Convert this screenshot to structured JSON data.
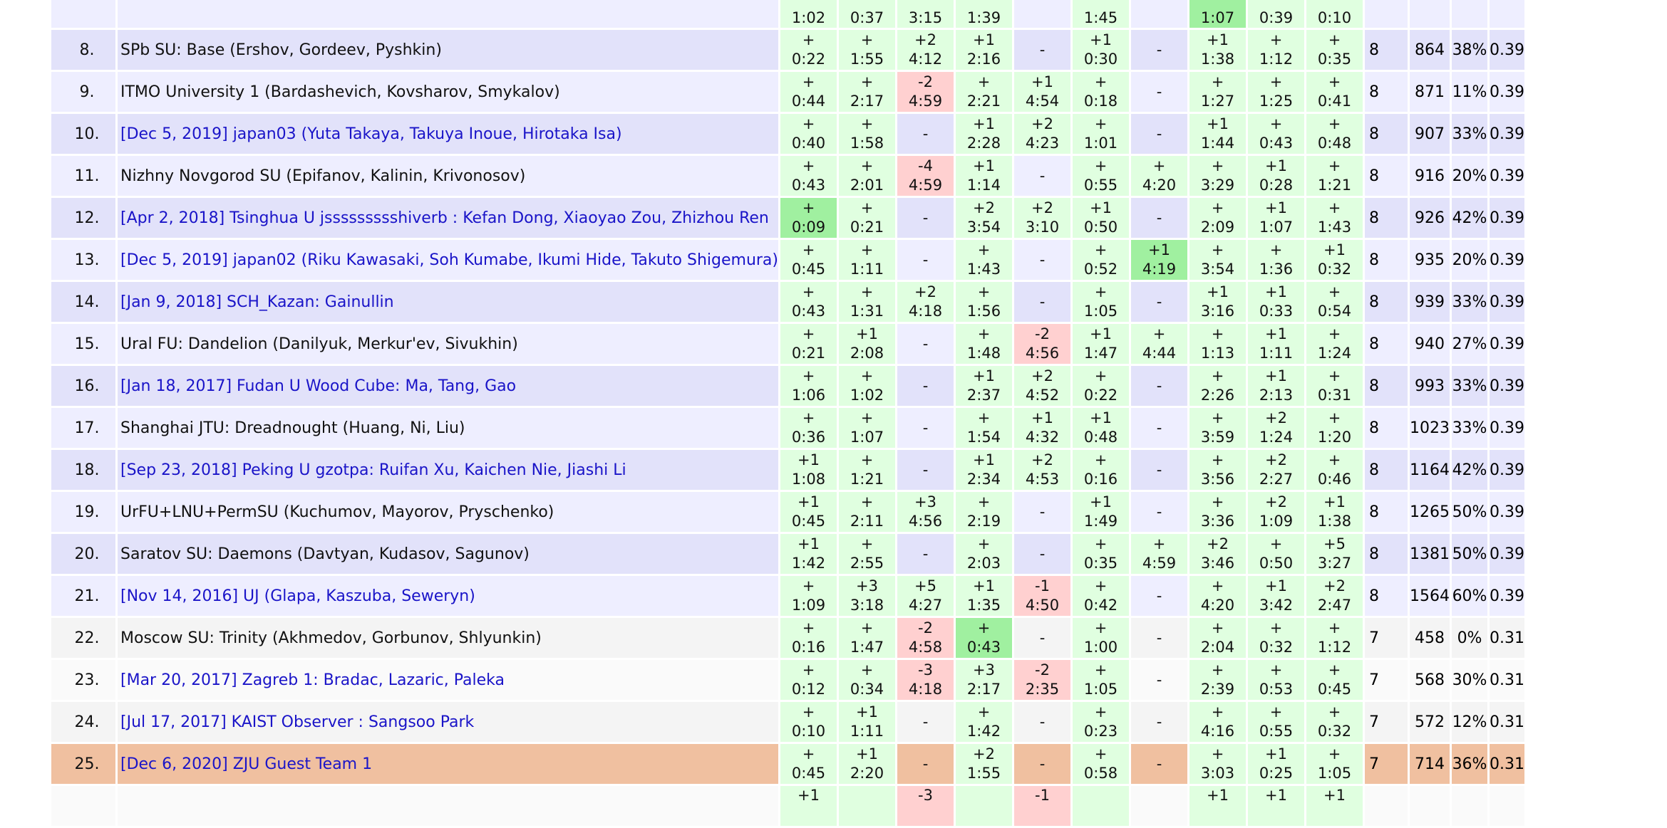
{
  "top_partial_row": {
    "cells": [
      "1:02",
      "0:37",
      "3:15",
      "1:39",
      "",
      "1:45",
      "",
      "1:07",
      "0:39",
      "0:10"
    ],
    "types": [
      "ok",
      "ok",
      "ok",
      "ok",
      "plain",
      "ok",
      "plain",
      "first",
      "ok",
      "ok"
    ]
  },
  "rows": [
    {
      "rank": "8.",
      "team": "SPb SU: Base (Ershov, Gordeev, Pyshkin)",
      "link": false,
      "group": "r",
      "probs": [
        [
          "+",
          "0:22",
          "ok"
        ],
        [
          "+",
          "1:55",
          "ok"
        ],
        [
          "+2",
          "4:12",
          "ok"
        ],
        [
          "+1",
          "2:16",
          "ok"
        ],
        [
          "-",
          "",
          "plain"
        ],
        [
          "+1",
          "0:30",
          "ok"
        ],
        [
          "-",
          "",
          "plain"
        ],
        [
          "+1",
          "1:38",
          "ok"
        ],
        [
          "+",
          "1:12",
          "ok"
        ],
        [
          "+",
          "0:35",
          "ok"
        ]
      ],
      "solved": "8",
      "penalty": "864",
      "rate": "38%",
      "dirt": "0.39"
    },
    {
      "rank": "9.",
      "team": "ITMO University 1 (Bardashevich, Kovsharov, Smykalov)",
      "link": false,
      "group": "r",
      "probs": [
        [
          "+",
          "0:44",
          "ok"
        ],
        [
          "+",
          "2:17",
          "ok"
        ],
        [
          "-2",
          "4:59",
          "fail"
        ],
        [
          "+",
          "2:21",
          "ok"
        ],
        [
          "+1",
          "4:54",
          "ok"
        ],
        [
          "+",
          "0:18",
          "ok"
        ],
        [
          "-",
          "",
          "plain"
        ],
        [
          "+",
          "1:27",
          "ok"
        ],
        [
          "+",
          "1:25",
          "ok"
        ],
        [
          "+",
          "0:41",
          "ok"
        ]
      ],
      "solved": "8",
      "penalty": "871",
      "rate": "11%",
      "dirt": "0.39"
    },
    {
      "rank": "10.",
      "team": "[Dec 5, 2019] japan03 (Yuta Takaya, Takuya Inoue, Hirotaka Isa)",
      "link": true,
      "group": "r",
      "probs": [
        [
          "+",
          "0:40",
          "ok"
        ],
        [
          "+",
          "1:58",
          "ok"
        ],
        [
          "-",
          "",
          "plain"
        ],
        [
          "+1",
          "2:28",
          "ok"
        ],
        [
          "+2",
          "4:23",
          "ok"
        ],
        [
          "+",
          "1:01",
          "ok"
        ],
        [
          "-",
          "",
          "plain"
        ],
        [
          "+1",
          "1:44",
          "ok"
        ],
        [
          "+",
          "0:43",
          "ok"
        ],
        [
          "+",
          "0:48",
          "ok"
        ]
      ],
      "solved": "8",
      "penalty": "907",
      "rate": "33%",
      "dirt": "0.39"
    },
    {
      "rank": "11.",
      "team": "Nizhny Novgorod SU (Epifanov, Kalinin, Krivonosov)",
      "link": false,
      "group": "r",
      "probs": [
        [
          "+",
          "0:43",
          "ok"
        ],
        [
          "+",
          "2:01",
          "ok"
        ],
        [
          "-4",
          "4:59",
          "fail"
        ],
        [
          "+1",
          "1:14",
          "ok"
        ],
        [
          "-",
          "",
          "plain"
        ],
        [
          "+",
          "0:55",
          "ok"
        ],
        [
          "+",
          "4:20",
          "ok"
        ],
        [
          "+",
          "3:29",
          "ok"
        ],
        [
          "+1",
          "0:28",
          "ok"
        ],
        [
          "+",
          "1:21",
          "ok"
        ]
      ],
      "solved": "8",
      "penalty": "916",
      "rate": "20%",
      "dirt": "0.39"
    },
    {
      "rank": "12.",
      "team": "[Apr 2, 2018] Tsinghua U jssssssssshiverb : Kefan Dong, Xiaoyao Zou, Zhizhou Ren",
      "link": true,
      "group": "r",
      "probs": [
        [
          "+",
          "0:09",
          "first"
        ],
        [
          "+",
          "0:21",
          "ok"
        ],
        [
          "-",
          "",
          "plain"
        ],
        [
          "+2",
          "3:54",
          "ok"
        ],
        [
          "+2",
          "3:10",
          "ok"
        ],
        [
          "+1",
          "0:50",
          "ok"
        ],
        [
          "-",
          "",
          "plain"
        ],
        [
          "+",
          "2:09",
          "ok"
        ],
        [
          "+1",
          "1:07",
          "ok"
        ],
        [
          "+",
          "1:43",
          "ok"
        ]
      ],
      "solved": "8",
      "penalty": "926",
      "rate": "42%",
      "dirt": "0.39"
    },
    {
      "rank": "13.",
      "team": "[Dec 5, 2019] japan02 (Riku Kawasaki, Soh Kumabe, Ikumi Hide, Takuto Shigemura)",
      "link": true,
      "group": "r",
      "probs": [
        [
          "+",
          "0:45",
          "ok"
        ],
        [
          "+",
          "1:11",
          "ok"
        ],
        [
          "-",
          "",
          "plain"
        ],
        [
          "+",
          "1:43",
          "ok"
        ],
        [
          "-",
          "",
          "plain"
        ],
        [
          "+",
          "0:52",
          "ok"
        ],
        [
          "+1",
          "4:19",
          "first"
        ],
        [
          "+",
          "3:54",
          "ok"
        ],
        [
          "+",
          "1:36",
          "ok"
        ],
        [
          "+1",
          "0:32",
          "ok"
        ]
      ],
      "solved": "8",
      "penalty": "935",
      "rate": "20%",
      "dirt": "0.39"
    },
    {
      "rank": "14.",
      "team": "[Jan 9, 2018] SCH_Kazan: Gainullin",
      "link": true,
      "group": "r",
      "probs": [
        [
          "+",
          "0:43",
          "ok"
        ],
        [
          "+",
          "1:31",
          "ok"
        ],
        [
          "+2",
          "4:18",
          "ok"
        ],
        [
          "+",
          "1:56",
          "ok"
        ],
        [
          "-",
          "",
          "plain"
        ],
        [
          "+",
          "1:05",
          "ok"
        ],
        [
          "-",
          "",
          "plain"
        ],
        [
          "+1",
          "3:16",
          "ok"
        ],
        [
          "+1",
          "0:33",
          "ok"
        ],
        [
          "+",
          "0:54",
          "ok"
        ]
      ],
      "solved": "8",
      "penalty": "939",
      "rate": "33%",
      "dirt": "0.39"
    },
    {
      "rank": "15.",
      "team": "Ural FU: Dandelion (Danilyuk, Merkur'ev, Sivukhin)",
      "link": false,
      "group": "r",
      "probs": [
        [
          "+",
          "0:21",
          "ok"
        ],
        [
          "+1",
          "2:08",
          "ok"
        ],
        [
          "-",
          "",
          "plain"
        ],
        [
          "+",
          "1:48",
          "ok"
        ],
        [
          "-2",
          "4:56",
          "fail"
        ],
        [
          "+1",
          "1:47",
          "ok"
        ],
        [
          "+",
          "4:44",
          "ok"
        ],
        [
          "+",
          "1:13",
          "ok"
        ],
        [
          "+1",
          "1:11",
          "ok"
        ],
        [
          "+",
          "1:24",
          "ok"
        ]
      ],
      "solved": "8",
      "penalty": "940",
      "rate": "27%",
      "dirt": "0.39"
    },
    {
      "rank": "16.",
      "team": "[Jan 18, 2017] Fudan U Wood Cube: Ma, Tang, Gao",
      "link": true,
      "group": "r",
      "probs": [
        [
          "+",
          "1:06",
          "ok"
        ],
        [
          "+",
          "1:02",
          "ok"
        ],
        [
          "-",
          "",
          "plain"
        ],
        [
          "+1",
          "2:37",
          "ok"
        ],
        [
          "+2",
          "4:52",
          "ok"
        ],
        [
          "+",
          "0:22",
          "ok"
        ],
        [
          "-",
          "",
          "plain"
        ],
        [
          "+",
          "2:26",
          "ok"
        ],
        [
          "+1",
          "2:13",
          "ok"
        ],
        [
          "+",
          "0:31",
          "ok"
        ]
      ],
      "solved": "8",
      "penalty": "993",
      "rate": "33%",
      "dirt": "0.39"
    },
    {
      "rank": "17.",
      "team": "Shanghai JTU: Dreadnought (Huang, Ni, Liu)",
      "link": false,
      "group": "r",
      "probs": [
        [
          "+",
          "0:36",
          "ok"
        ],
        [
          "+",
          "1:07",
          "ok"
        ],
        [
          "-",
          "",
          "plain"
        ],
        [
          "+",
          "1:54",
          "ok"
        ],
        [
          "+1",
          "4:32",
          "ok"
        ],
        [
          "+1",
          "0:48",
          "ok"
        ],
        [
          "-",
          "",
          "plain"
        ],
        [
          "+",
          "3:59",
          "ok"
        ],
        [
          "+2",
          "1:24",
          "ok"
        ],
        [
          "+",
          "1:20",
          "ok"
        ]
      ],
      "solved": "8",
      "penalty": "1023",
      "rate": "33%",
      "dirt": "0.39"
    },
    {
      "rank": "18.",
      "team": "[Sep 23, 2018] Peking U gzotpa: Ruifan Xu, Kaichen Nie, Jiashi Li",
      "link": true,
      "group": "r",
      "probs": [
        [
          "+1",
          "1:08",
          "ok"
        ],
        [
          "+",
          "1:21",
          "ok"
        ],
        [
          "-",
          "",
          "plain"
        ],
        [
          "+1",
          "2:34",
          "ok"
        ],
        [
          "+2",
          "4:53",
          "ok"
        ],
        [
          "+",
          "0:16",
          "ok"
        ],
        [
          "-",
          "",
          "plain"
        ],
        [
          "+",
          "3:56",
          "ok"
        ],
        [
          "+2",
          "2:27",
          "ok"
        ],
        [
          "+",
          "0:46",
          "ok"
        ]
      ],
      "solved": "8",
      "penalty": "1164",
      "rate": "42%",
      "dirt": "0.39"
    },
    {
      "rank": "19.",
      "team": "UrFU+LNU+PermSU (Kuchumov, Mayorov, Pryschenko)",
      "link": false,
      "group": "r",
      "probs": [
        [
          "+1",
          "0:45",
          "ok"
        ],
        [
          "+",
          "2:11",
          "ok"
        ],
        [
          "+3",
          "4:56",
          "ok"
        ],
        [
          "+",
          "2:19",
          "ok"
        ],
        [
          "-",
          "",
          "plain"
        ],
        [
          "+1",
          "1:49",
          "ok"
        ],
        [
          "-",
          "",
          "plain"
        ],
        [
          "+",
          "3:36",
          "ok"
        ],
        [
          "+2",
          "1:09",
          "ok"
        ],
        [
          "+1",
          "1:38",
          "ok"
        ]
      ],
      "solved": "8",
      "penalty": "1265",
      "rate": "50%",
      "dirt": "0.39"
    },
    {
      "rank": "20.",
      "team": "Saratov SU: Daemons (Davtyan, Kudasov, Sagunov)",
      "link": false,
      "group": "r",
      "probs": [
        [
          "+1",
          "1:42",
          "ok"
        ],
        [
          "+",
          "2:55",
          "ok"
        ],
        [
          "-",
          "",
          "plain"
        ],
        [
          "+",
          "2:03",
          "ok"
        ],
        [
          "-",
          "",
          "plain"
        ],
        [
          "+",
          "0:35",
          "ok"
        ],
        [
          "+",
          "4:59",
          "ok"
        ],
        [
          "+2",
          "3:46",
          "ok"
        ],
        [
          "+",
          "0:50",
          "ok"
        ],
        [
          "+5",
          "3:27",
          "ok"
        ]
      ],
      "solved": "8",
      "penalty": "1381",
      "rate": "50%",
      "dirt": "0.39"
    },
    {
      "rank": "21.",
      "team": "[Nov 14, 2016] UJ (Glapa, Kaszuba, Seweryn)",
      "link": true,
      "group": "r",
      "probs": [
        [
          "+",
          "1:09",
          "ok"
        ],
        [
          "+3",
          "3:18",
          "ok"
        ],
        [
          "+5",
          "4:27",
          "ok"
        ],
        [
          "+1",
          "1:35",
          "ok"
        ],
        [
          "-1",
          "4:50",
          "fail"
        ],
        [
          "+",
          "0:42",
          "ok"
        ],
        [
          "-",
          "",
          "plain"
        ],
        [
          "+",
          "4:20",
          "ok"
        ],
        [
          "+1",
          "3:42",
          "ok"
        ],
        [
          "+2",
          "2:47",
          "ok"
        ]
      ],
      "solved": "8",
      "penalty": "1564",
      "rate": "60%",
      "dirt": "0.39"
    },
    {
      "rank": "22.",
      "team": "Moscow SU: Trinity (Akhmedov, Gorbunov, Shlyunkin)",
      "link": false,
      "group": "g",
      "probs": [
        [
          "+",
          "0:16",
          "ok"
        ],
        [
          "+",
          "1:47",
          "ok"
        ],
        [
          "-2",
          "4:58",
          "fail"
        ],
        [
          "+",
          "0:43",
          "first"
        ],
        [
          "-",
          "",
          "plain"
        ],
        [
          "+",
          "1:00",
          "ok"
        ],
        [
          "-",
          "",
          "plain"
        ],
        [
          "+",
          "2:04",
          "ok"
        ],
        [
          "+",
          "0:32",
          "ok"
        ],
        [
          "+",
          "1:12",
          "ok"
        ]
      ],
      "solved": "7",
      "penalty": "458",
      "rate": "0%",
      "dirt": "0.31"
    },
    {
      "rank": "23.",
      "team": "[Mar 20, 2017] Zagreb 1: Bradac, Lazaric, Paleka",
      "link": true,
      "group": "g",
      "probs": [
        [
          "+",
          "0:12",
          "ok"
        ],
        [
          "+",
          "0:34",
          "ok"
        ],
        [
          "-3",
          "4:18",
          "fail"
        ],
        [
          "+3",
          "2:17",
          "ok"
        ],
        [
          "-2",
          "2:35",
          "fail"
        ],
        [
          "+",
          "1:05",
          "ok"
        ],
        [
          "-",
          "",
          "plain"
        ],
        [
          "+",
          "2:39",
          "ok"
        ],
        [
          "+",
          "0:53",
          "ok"
        ],
        [
          "+",
          "0:45",
          "ok"
        ]
      ],
      "solved": "7",
      "penalty": "568",
      "rate": "30%",
      "dirt": "0.31"
    },
    {
      "rank": "24.",
      "team": "[Jul 17, 2017] KAIST Observer : Sangsoo Park",
      "link": true,
      "group": "g",
      "probs": [
        [
          "+",
          "0:10",
          "ok"
        ],
        [
          "+1",
          "1:11",
          "ok"
        ],
        [
          "-",
          "",
          "plain"
        ],
        [
          "+",
          "1:42",
          "ok"
        ],
        [
          "-",
          "",
          "plain"
        ],
        [
          "+",
          "0:23",
          "ok"
        ],
        [
          "-",
          "",
          "plain"
        ],
        [
          "+",
          "4:16",
          "ok"
        ],
        [
          "+",
          "0:55",
          "ok"
        ],
        [
          "+",
          "0:32",
          "ok"
        ]
      ],
      "solved": "7",
      "penalty": "572",
      "rate": "12%",
      "dirt": "0.31"
    },
    {
      "rank": "25.",
      "team": "[Dec 6, 2020] ZJU Guest Team 1",
      "link": true,
      "group": "hl",
      "probs": [
        [
          "+",
          "0:45",
          "ok"
        ],
        [
          "+1",
          "2:20",
          "ok"
        ],
        [
          "-",
          "",
          "plain"
        ],
        [
          "+2",
          "1:55",
          "ok"
        ],
        [
          "-",
          "",
          "plain"
        ],
        [
          "+",
          "0:58",
          "ok"
        ],
        [
          "-",
          "",
          "plain"
        ],
        [
          "+",
          "3:03",
          "ok"
        ],
        [
          "+1",
          "0:25",
          "ok"
        ],
        [
          "+",
          "1:05",
          "ok"
        ]
      ],
      "solved": "7",
      "penalty": "714",
      "rate": "36%",
      "dirt": "0.31"
    }
  ],
  "bottom_partial_row": {
    "cells": [
      "+1",
      "",
      "-3",
      "",
      "-1",
      "",
      "",
      "+1",
      "+1",
      "+1"
    ],
    "types": [
      "ok",
      "ok",
      "fail",
      "ok",
      "fail",
      "ok",
      "plain",
      "ok",
      "ok",
      "ok"
    ]
  },
  "colors": {
    "accepted": "#e0ffe0",
    "first_solve": "#a0f0a0",
    "rejected": "#ffd0d0",
    "link": "#1a14c8",
    "highlight": "#f0c0a0"
  }
}
